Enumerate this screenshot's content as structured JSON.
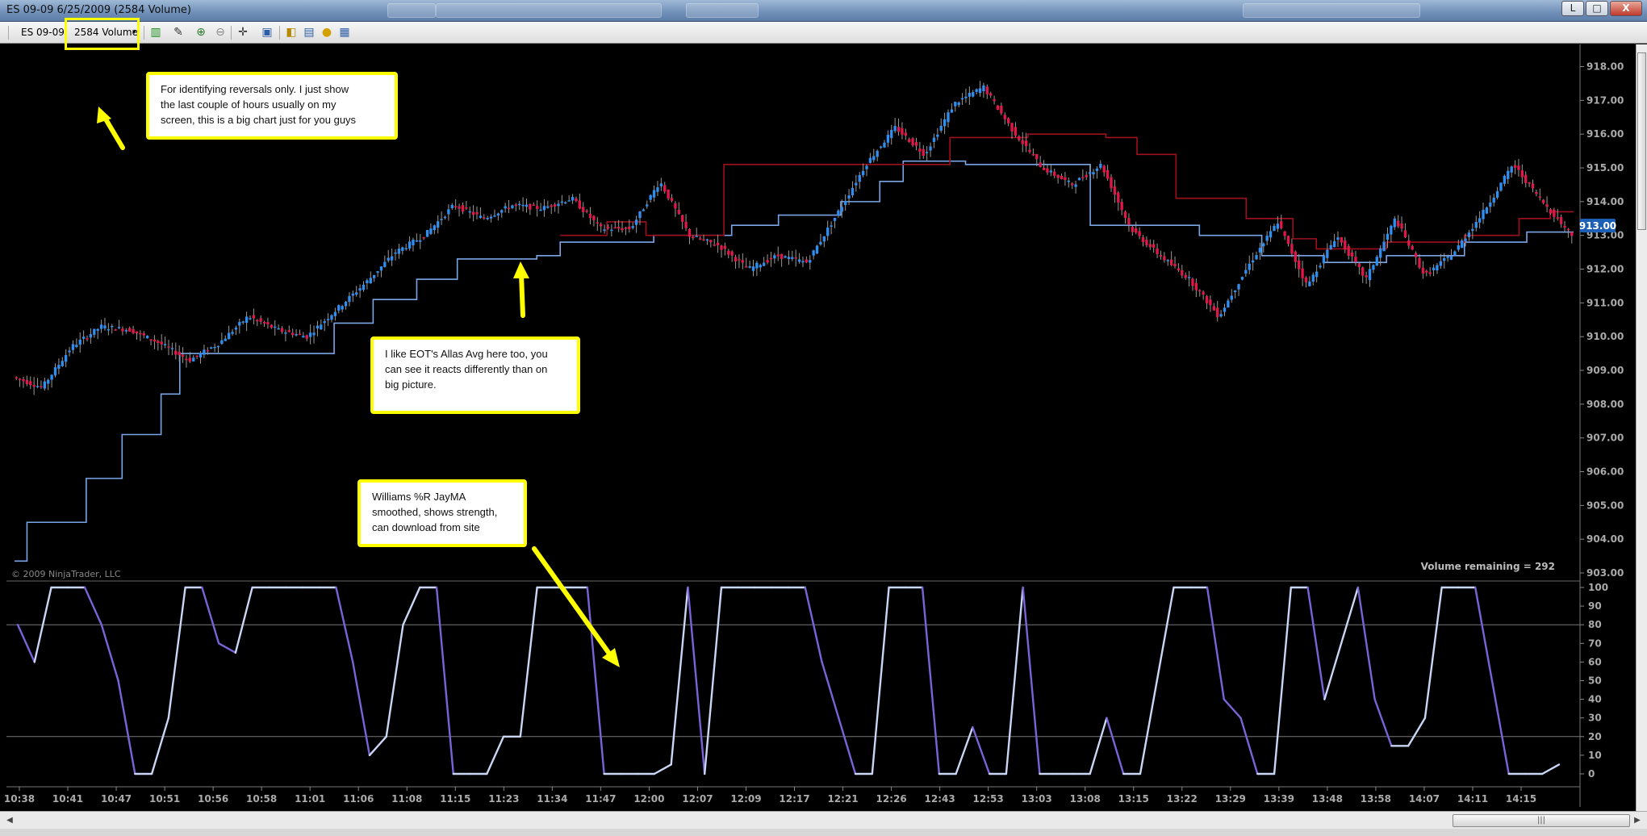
{
  "window": {
    "title": "ES 09-09  6/25/2009 (2584 Volume)",
    "buttons": {
      "minimize": "L",
      "restore": "□",
      "close": "X"
    }
  },
  "toolbar": {
    "instrument": "ES 09-09",
    "period": "2584 Volume",
    "icons": [
      "bar-style-icon",
      "pencil-draw-icon",
      "zoom-in-icon",
      "zoom-out-icon",
      "crosshair-icon",
      "properties-icon",
      "data-box-icon",
      "indicators-icon",
      "strategies-icon",
      "table-icon"
    ]
  },
  "chart": {
    "copyright": "© 2009 NinjaTrader, LLC",
    "volume_remaining": "Volume remaining = 292",
    "current_price": "913.00",
    "price_ticks": [
      "918.00",
      "917.00",
      "916.00",
      "915.00",
      "914.00",
      "913.00",
      "912.00",
      "911.00",
      "910.00",
      "909.00",
      "908.00",
      "907.00",
      "906.00",
      "905.00",
      "904.00",
      "903.00"
    ],
    "time_ticks": [
      "10:38",
      "10:41",
      "10:47",
      "10:51",
      "10:56",
      "10:58",
      "11:01",
      "11:06",
      "11:08",
      "11:15",
      "11:23",
      "11:34",
      "11:47",
      "12:00",
      "12:07",
      "12:09",
      "12:17",
      "12:21",
      "12:26",
      "12:43",
      "12:53",
      "13:03",
      "13:08",
      "13:15",
      "13:22",
      "13:29",
      "13:39",
      "13:48",
      "13:58",
      "14:07",
      "14:11",
      "14:15"
    ],
    "osc_ticks": [
      "100",
      "90",
      "80",
      "70",
      "60",
      "50",
      "40",
      "30",
      "20",
      "10",
      "0"
    ],
    "colors": {
      "up": "#2f8ff0",
      "down": "#e0184a",
      "support": "#7aa6e8",
      "resistance": "#a0101c",
      "osc_down": "#7a63d8",
      "osc_up": "#c9d6f5"
    }
  },
  "chart_data": {
    "type": "candlestick",
    "title": "",
    "ylim": [
      903,
      918.3
    ],
    "price_path": [
      908.8,
      908.5,
      909.7,
      910.3,
      910.2,
      909.8,
      909.3,
      909.8,
      910.6,
      910.2,
      910.0,
      910.8,
      911.6,
      912.5,
      913.0,
      913.9,
      913.5,
      913.9,
      913.8,
      914.1,
      913.2,
      913.2,
      914.6,
      913.0,
      912.7,
      912.0,
      912.4,
      912.2,
      913.6,
      915.1,
      916.2,
      915.4,
      916.9,
      917.4,
      916.1,
      915.0,
      914.5,
      915.1,
      913.2,
      912.4,
      911.7,
      910.6,
      912.1,
      913.4,
      911.5,
      913.0,
      911.7,
      913.5,
      911.8,
      912.5,
      913.7,
      915.1,
      914.0,
      913.0
    ],
    "support_steps": [
      [
        0,
        903.35
      ],
      [
        0.008,
        904.5
      ],
      [
        0.046,
        905.8
      ],
      [
        0.069,
        907.1
      ],
      [
        0.094,
        908.3
      ],
      [
        0.106,
        909.5
      ],
      [
        0.205,
        910.4
      ],
      [
        0.23,
        911.1
      ],
      [
        0.258,
        911.7
      ],
      [
        0.284,
        912.3
      ],
      [
        0.335,
        912.4
      ],
      [
        0.35,
        912.8
      ],
      [
        0.38,
        912.8
      ],
      [
        0.41,
        913.0
      ],
      [
        0.46,
        913.3
      ],
      [
        0.49,
        913.6
      ],
      [
        0.53,
        914.0
      ],
      [
        0.555,
        914.6
      ],
      [
        0.57,
        915.2
      ],
      [
        0.61,
        915.1
      ],
      [
        0.69,
        913.3
      ],
      [
        0.76,
        913.0
      ],
      [
        0.8,
        912.4
      ],
      [
        0.84,
        912.2
      ],
      [
        0.88,
        912.4
      ],
      [
        0.93,
        912.8
      ],
      [
        0.97,
        913.1
      ]
    ],
    "resistance_steps": [
      [
        0.35,
        913.0
      ],
      [
        0.38,
        913.4
      ],
      [
        0.405,
        913.0
      ],
      [
        0.455,
        915.1
      ],
      [
        0.6,
        915.9
      ],
      [
        0.65,
        916.0
      ],
      [
        0.7,
        915.9
      ],
      [
        0.72,
        915.4
      ],
      [
        0.745,
        914.1
      ],
      [
        0.79,
        913.5
      ],
      [
        0.82,
        912.9
      ],
      [
        0.835,
        912.6
      ],
      [
        0.88,
        912.8
      ],
      [
        0.93,
        913.0
      ],
      [
        0.965,
        913.5
      ],
      [
        0.985,
        913.7
      ]
    ],
    "williams_r": [
      80,
      60,
      100,
      100,
      100,
      80,
      50,
      0,
      0,
      30,
      100,
      100,
      70,
      65,
      100,
      100,
      100,
      100,
      100,
      100,
      60,
      10,
      20,
      80,
      100,
      100,
      0,
      0,
      0,
      20,
      20,
      100,
      100,
      100,
      100,
      0,
      0,
      0,
      0,
      5,
      100,
      0,
      100,
      100,
      100,
      100,
      100,
      100,
      60,
      30,
      0,
      0,
      100,
      100,
      100,
      0,
      0,
      25,
      0,
      0,
      100,
      0,
      0,
      0,
      0,
      30,
      0,
      0,
      50,
      100,
      100,
      100,
      40,
      30,
      0,
      0,
      100,
      100,
      40,
      70,
      100,
      40,
      15,
      15,
      30,
      100,
      100,
      100,
      50,
      0,
      0,
      0,
      5
    ]
  },
  "annotations": {
    "note1": "For identifying reversals only.  I just show\nthe last couple of hours usually on my\nscreen, this is a big chart just for you guys",
    "note2": "I like EOT's Allas Avg here too, you\ncan see it reacts differently than on\nbig picture.",
    "note3": "Williams %R JayMA\nsmoothed, shows strength,\ncan download from site"
  }
}
